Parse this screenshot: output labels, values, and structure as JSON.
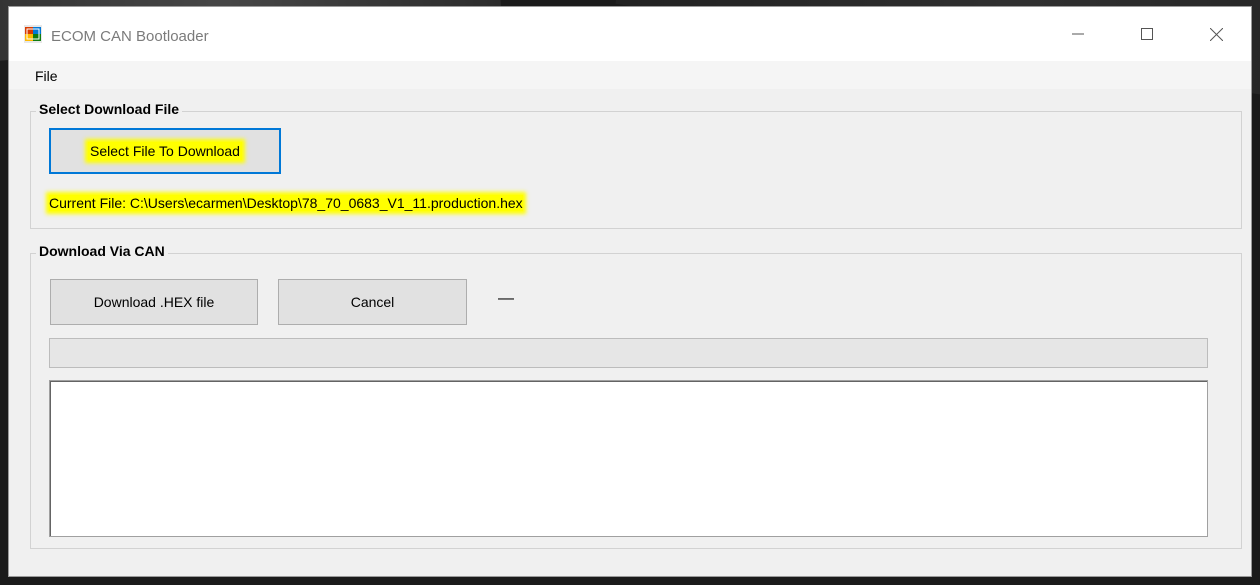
{
  "window": {
    "title": "ECOM CAN Bootloader",
    "icons": {
      "app": "app-icon",
      "minimize": "minimize-icon",
      "maximize": "maximize-icon",
      "close": "close-icon"
    }
  },
  "menu": {
    "file_label": "File"
  },
  "select_group": {
    "title": "Select Download File",
    "select_button_label": "Select File To Download",
    "current_file_text": "Current File: C:\\Users\\ecarmen\\Desktop\\78_70_0683_V1_11.production.hex"
  },
  "download_group": {
    "title": "Download Via CAN",
    "download_button_label": "Download .HEX file",
    "cancel_button_label": "Cancel",
    "status_text": "—",
    "progress_fraction": 0,
    "log_text": ""
  },
  "colors": {
    "highlight": "#ffff00",
    "focus_border": "#0078d7"
  }
}
